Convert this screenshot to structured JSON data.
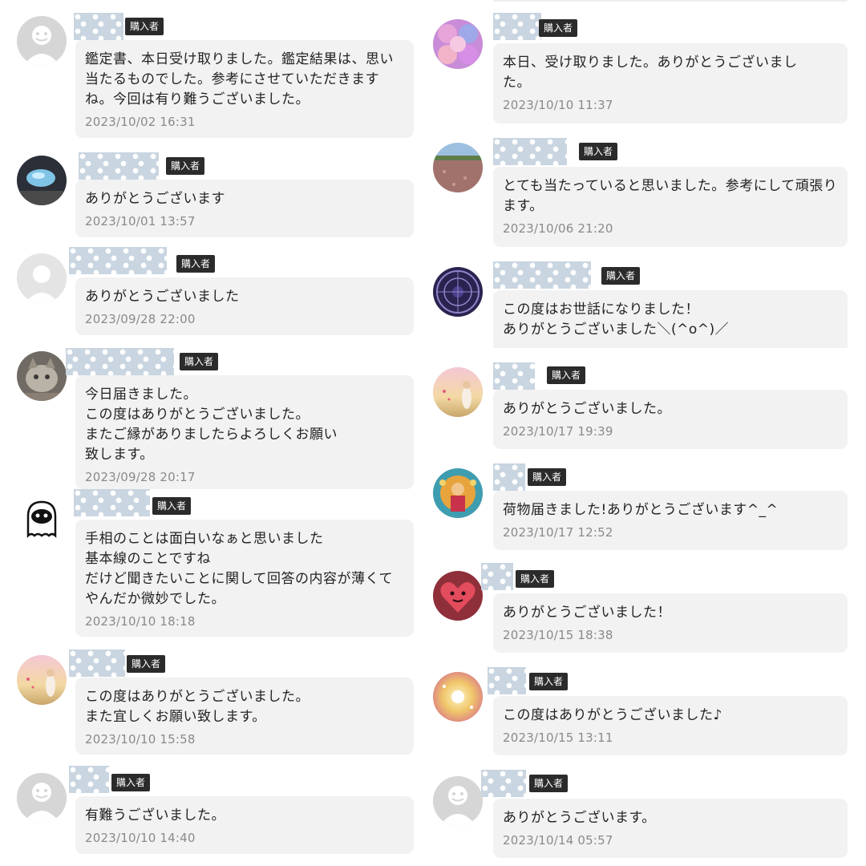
{
  "badge_label": "購入者",
  "left_reviews": [
    {
      "comment": "鑑定書、本日受け取りました。鑑定結果は、思い当たるものでした。参考にさせていただきますね。今回は有り難うございました。",
      "date": "2023/10/02 16:31",
      "avatar": "default-avatar"
    },
    {
      "comment": "ありがとうございます",
      "date": "2023/10/01 13:57",
      "avatar": "crystal-avatar"
    },
    {
      "comment": "ありがとうございました",
      "date": "2023/09/28 22:00",
      "avatar": "silhouette-avatar"
    },
    {
      "comment": "今日届きました。\nこの度はありがとうございました。\nまたご縁がありましたらよろしくお願い\n致します。",
      "date": "2023/09/28 20:17",
      "avatar": "cat-avatar"
    },
    {
      "comment": "手相のことは面白いなぁと思いました\n基本線のことですね\nだけど聞きたいことに関して回答の内容が薄くて\nやんだか微妙でした。",
      "date": "2023/10/10 18:18",
      "avatar": "ghost-avatar"
    },
    {
      "comment": "この度はありがとうございました。\nまた宜しくお願い致します。",
      "date": "2023/10/10 15:58",
      "avatar": "sunset-avatar"
    },
    {
      "comment": "有難うございました。",
      "date": "2023/10/10 14:40",
      "avatar": "default-avatar"
    }
  ],
  "right_reviews": [
    {
      "comment": "本日、受け取りました。ありがとうございました。",
      "date": "2023/10/10 11:37",
      "avatar": "roses-avatar"
    },
    {
      "comment": "とても当たっていると思いました。参考にして頑張ります。",
      "date": "2023/10/06 21:20",
      "avatar": "field-avatar"
    },
    {
      "comment": "この度はお世話になりました！\nありがとうございました＼(^o^)／",
      "date": "",
      "avatar": "zodiac-avatar"
    },
    {
      "comment": "ありがとうございました。",
      "date": "2023/10/17 19:39",
      "avatar": "sunset-avatar"
    },
    {
      "comment": "荷物届きました!ありがとうございます^_^",
      "date": "2023/10/17 12:52",
      "avatar": "deity-avatar"
    },
    {
      "comment": "ありがとうございました！",
      "date": "2023/10/15 18:38",
      "avatar": "heart-avatar"
    },
    {
      "comment": "この度はありがとうございました♪",
      "date": "2023/10/15 13:11",
      "avatar": "sparkle-avatar"
    },
    {
      "comment": "ありがとうございます。",
      "date": "2023/10/14 05:57",
      "avatar": "default-avatar"
    }
  ],
  "colors": {
    "bubble": "#f2f2f2",
    "badge": "#2b2b2b",
    "nickname_mask": "#c9d5e0",
    "date_text": "#8a8a8a"
  }
}
